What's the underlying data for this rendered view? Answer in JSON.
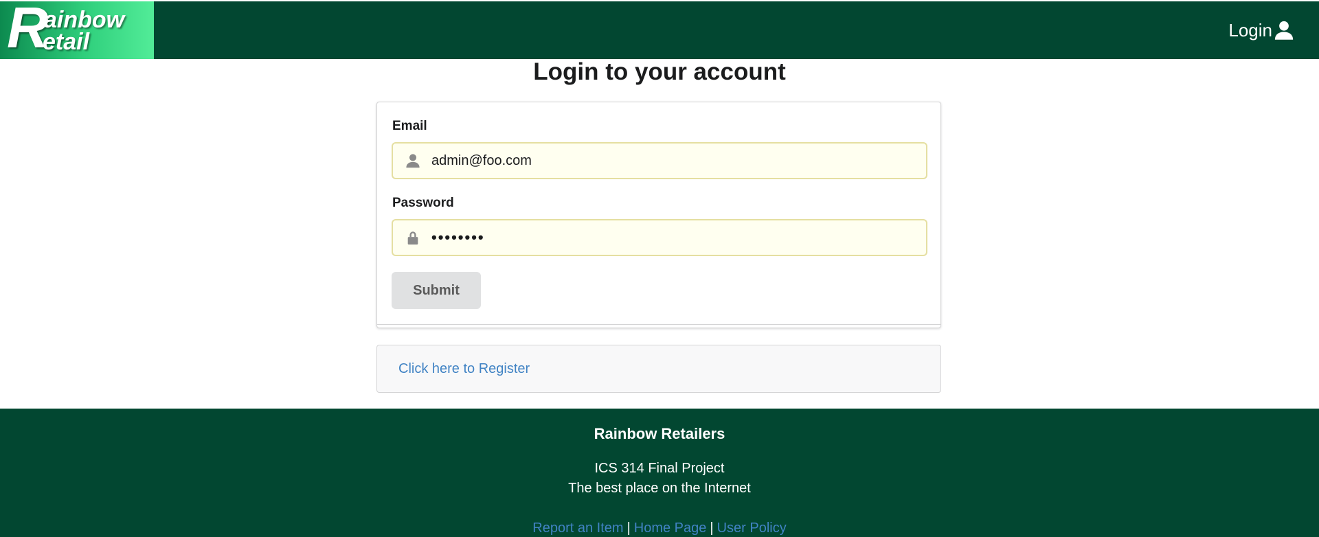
{
  "header": {
    "logo": {
      "line1_initial": "R",
      "line1_rest": "ainbow",
      "line2_initial": "R",
      "line2_rest": "etail"
    },
    "login_label": "Login",
    "login_icon": "user-icon"
  },
  "main": {
    "title": "Login to your account",
    "form": {
      "email_label": "Email",
      "email_value": "admin@foo.com",
      "email_icon": "user-icon",
      "password_label": "Password",
      "password_value": "••••••••",
      "password_icon": "lock-icon",
      "submit_label": "Submit"
    },
    "register_link": "Click here to Register"
  },
  "footer": {
    "title": "Rainbow Retailers",
    "line1": "ICS 314 Final Project",
    "line2": "The best place on the Internet",
    "links": [
      "Report an Item",
      "Home Page",
      "User Policy"
    ],
    "separator": "|"
  },
  "colors": {
    "header_bg": "#024731",
    "link": "#4183c4",
    "input_bg": "#fffff0",
    "input_border": "#e5dfa1",
    "button_bg": "#e0e1e2"
  }
}
